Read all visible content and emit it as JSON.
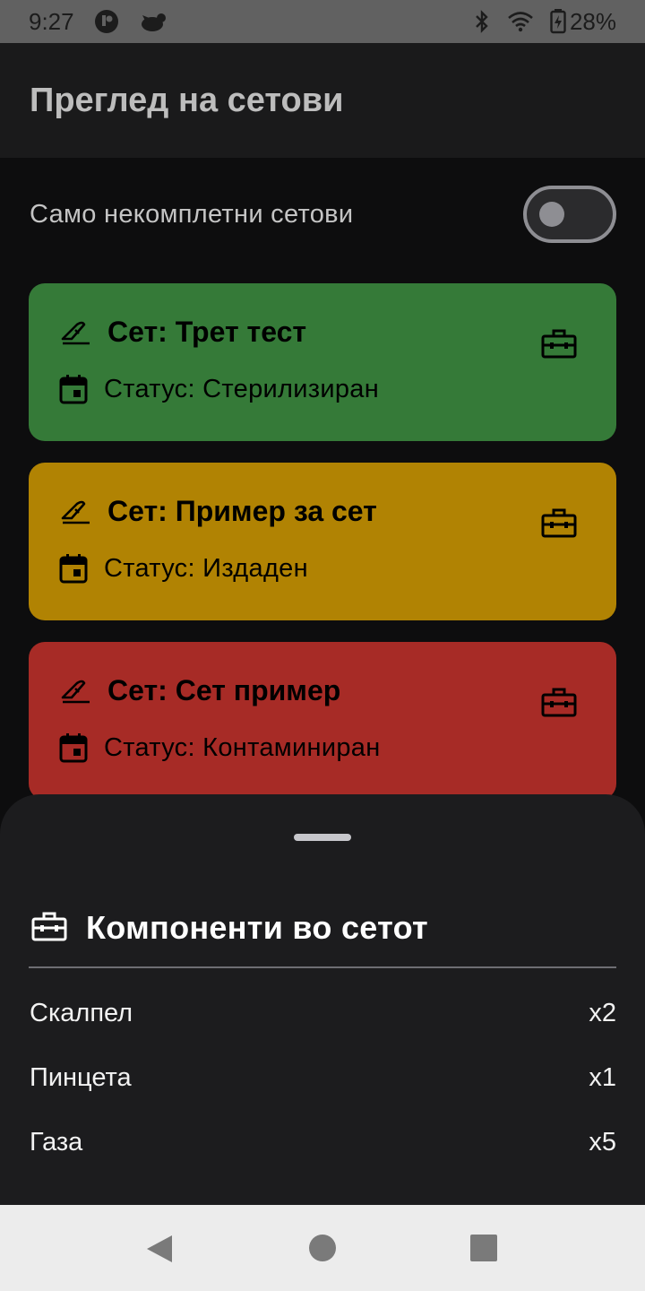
{
  "status_bar": {
    "time": "9:27",
    "battery": "28%"
  },
  "app_bar": {
    "title": "Преглед на сетови"
  },
  "filter": {
    "label": "Само некомплетни сетови",
    "toggle_on": false
  },
  "cards": [
    {
      "title": "Сет: Трет тест",
      "status": "Статус: Стерилизиран",
      "color": "#357a38"
    },
    {
      "title": "Сет: Пример за сет",
      "status": "Статус: Издаден",
      "color": "#b18303"
    },
    {
      "title": "Сет: Сет пример",
      "status": "Статус: Контаминиран",
      "color": "#a72b26"
    }
  ],
  "sheet": {
    "title": "Компоненти во сетот",
    "items": [
      {
        "name": "Скалпел",
        "qty": "x2"
      },
      {
        "name": "Пинцета",
        "qty": "x1"
      },
      {
        "name": "Газа",
        "qty": "x5"
      }
    ]
  }
}
